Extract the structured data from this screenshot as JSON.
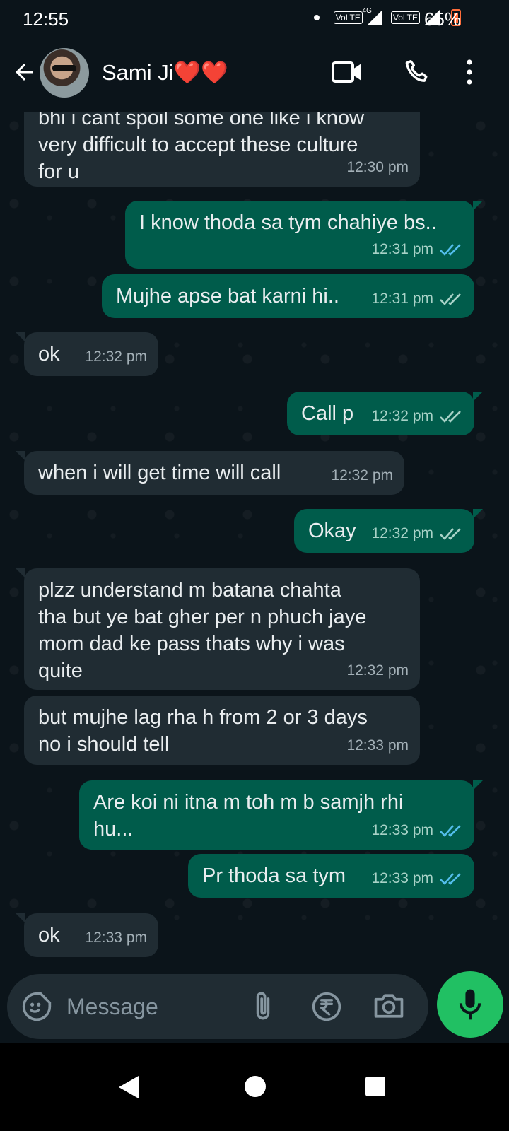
{
  "status_bar": {
    "time": "12:55",
    "network_1": "VoLTE",
    "network_1_gen": "4G",
    "network_2": "VoLTE",
    "battery": "65%"
  },
  "header": {
    "contact_name": "Sami Ji",
    "contact_emoji": "❤️❤️",
    "icons": [
      "back-arrow-icon",
      "video-call-icon",
      "phone-call-icon",
      "more-options-icon"
    ]
  },
  "messages": [
    {
      "dir": "in",
      "text": "bhi i cant spoil some one like i know\nvery difficult to accept these culture\nfor u",
      "time": "12:30 pm"
    },
    {
      "dir": "out",
      "text": "I know thoda sa tym chahiye bs..",
      "time": "12:31 pm",
      "status": "read"
    },
    {
      "dir": "out",
      "text": "Mujhe apse bat karni hi..",
      "time": "12:31 pm",
      "status": "delivered"
    },
    {
      "dir": "in",
      "text": "ok",
      "time": "12:32 pm"
    },
    {
      "dir": "out",
      "text": "Call p",
      "time": "12:32 pm",
      "status": "delivered"
    },
    {
      "dir": "in",
      "text": "when i will get time will call",
      "time": "12:32 pm"
    },
    {
      "dir": "out",
      "text": "Okay",
      "time": "12:32 pm",
      "status": "delivered"
    },
    {
      "dir": "in",
      "text": "plzz understand m batana chahta\ntha but ye bat gher per n phuch jaye\nmom dad ke pass thats why i was\nquite",
      "time": "12:32 pm"
    },
    {
      "dir": "in",
      "text": "but mujhe lag rha h from 2 or 3 days\nno i should tell",
      "time": "12:33 pm"
    },
    {
      "dir": "out",
      "text": "Are koi ni itna m toh m b samjh rhi\nhu...",
      "time": "12:33 pm",
      "status": "read"
    },
    {
      "dir": "out",
      "text": "Pr thoda sa tym",
      "time": "12:33 pm",
      "status": "read"
    },
    {
      "dir": "in",
      "text": "ok",
      "time": "12:33 pm"
    }
  ],
  "composer": {
    "placeholder": "Message",
    "icons": [
      "emoji-sticker-icon",
      "attach-icon",
      "rupee-payment-icon",
      "camera-icon",
      "mic-icon"
    ]
  },
  "colors": {
    "background": "#0b141a",
    "incoming_bubble": "#202c33",
    "outgoing_bubble": "#005c4b",
    "read_tick": "#53bdeb",
    "delivered_tick": "#a8d2c7",
    "mic_button": "#21c063"
  }
}
